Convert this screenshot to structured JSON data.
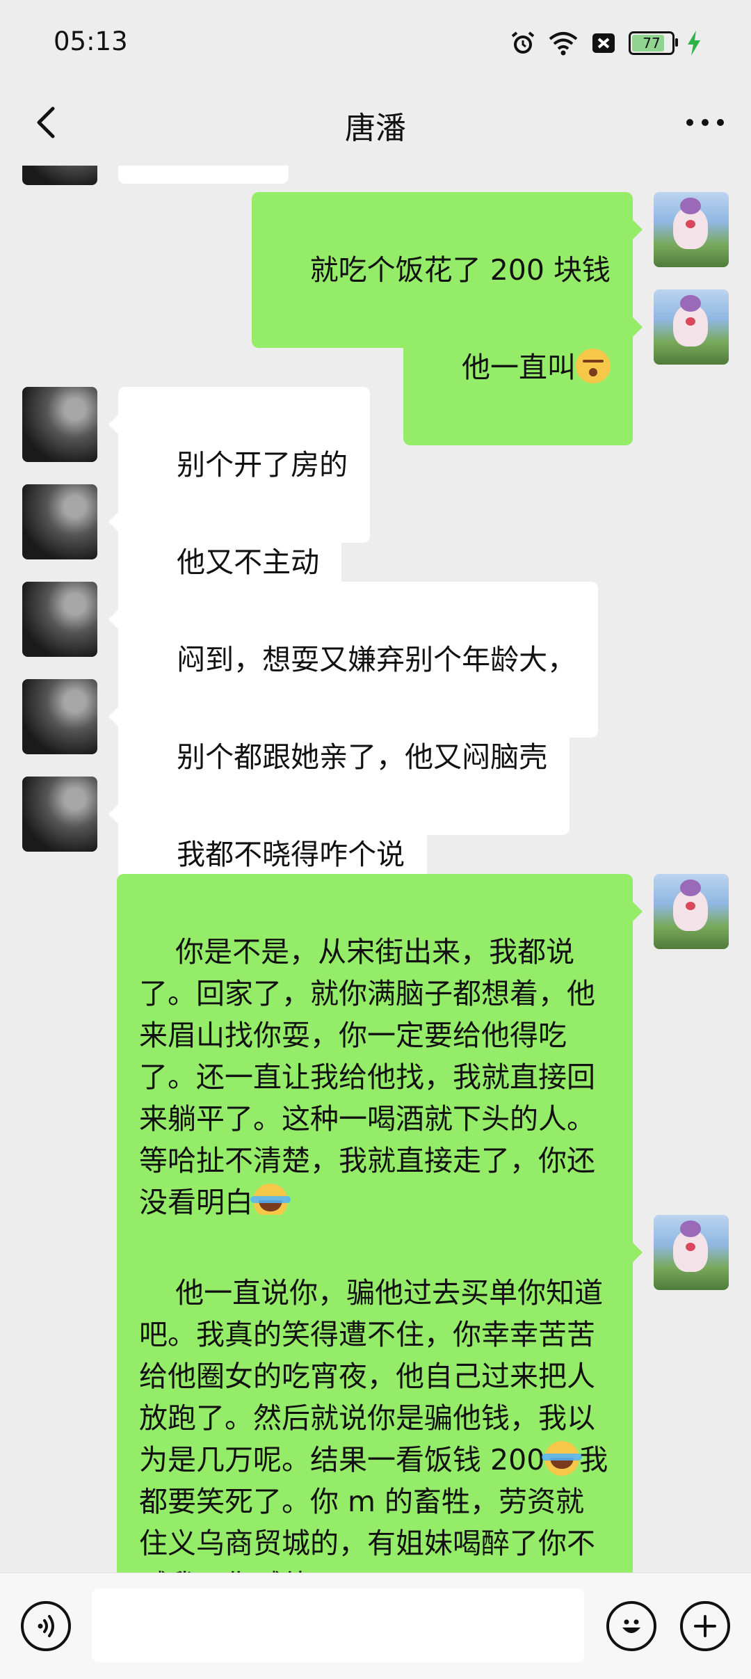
{
  "status_bar": {
    "time": "05:13",
    "battery_level": "77",
    "icons": [
      "alarm-icon",
      "wifi-icon",
      "sim-off-icon",
      "battery-icon",
      "charging-icon"
    ]
  },
  "header": {
    "title": "唐潘",
    "back_icon": "chevron-left-icon",
    "more_icon": "more-dots-icon"
  },
  "messages": [
    {
      "side": "right",
      "text": "就吃个饭花了 200 块钱"
    },
    {
      "side": "right",
      "text": "他一直叫",
      "emoji_after": "kiss-face"
    },
    {
      "side": "left",
      "text": "别个开了房的"
    },
    {
      "side": "left",
      "text": "他又不主动"
    },
    {
      "side": "left",
      "text": "闷到，想耍又嫌弃别个年龄大，"
    },
    {
      "side": "left",
      "text": "别个都跟她亲了，他又闷脑壳"
    },
    {
      "side": "left",
      "text": "我都不晓得咋个说"
    },
    {
      "side": "right",
      "text": "你是不是，从宋街出来，我都说了。回家了，就你满脑子都想着，他来眉山找你耍，你一定要给他得吃了。还一直让我给他找，我就直接回来躺平了。这种一喝酒就下头的人。等哈扯不清楚，我就直接走了，你还没看明白",
      "emoji_after": "crying-laughing"
    },
    {
      "side": "right",
      "text_part1": "他一直说你，骗他过去买单你知道吧。我真的笑得遭不住，你幸幸苦苦给他圈女的吃宵夜，他自己过来把人放跑了。然后就说你是骗他钱，我以为是几万呢。结果一看饭钱 200",
      "text_part2": "我都要笑死了。你 m 的畜牲，劳资就住义乌商贸城的，有姐妹喝醉了你不喊我，你喊他？",
      "emoji_mid": "crying-laughing"
    }
  ],
  "bottom_bar": {
    "voice_icon": "voice-input-icon",
    "emoji_icon": "emoji-icon",
    "plus_icon": "plus-icon",
    "input_value": ""
  },
  "colors": {
    "background": "#ededed",
    "sent_bubble": "#95ec69",
    "received_bubble": "#ffffff"
  }
}
